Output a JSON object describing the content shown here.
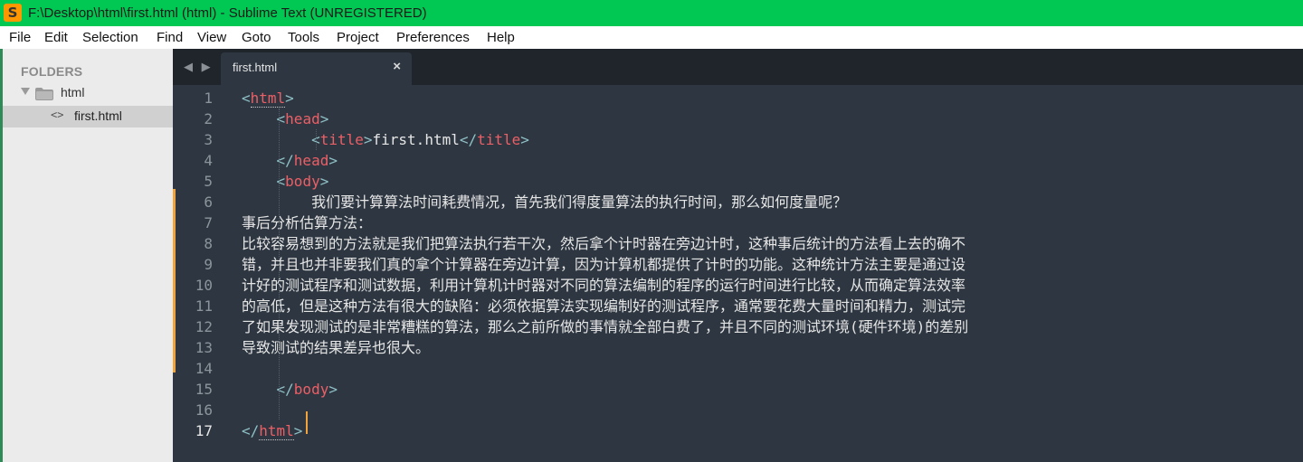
{
  "window": {
    "title": "F:\\Desktop\\html\\first.html (html) - Sublime Text (UNREGISTERED)",
    "app_icon": "S"
  },
  "menu": [
    "File",
    "Edit",
    "Selection",
    "Find",
    "View",
    "Goto",
    "Tools",
    "Project",
    "Preferences",
    "Help"
  ],
  "sidebar": {
    "heading": "FOLDERS",
    "folder": "html",
    "file": "first.html",
    "file_icon": "<>"
  },
  "tabbar": {
    "nav": "◀ ▶",
    "tab_label": "first.html",
    "close": "×"
  },
  "editor": {
    "active_line": 17,
    "line_numbers": [
      "1",
      "2",
      "3",
      "4",
      "5",
      "6",
      "7",
      "8",
      "9",
      "10",
      "11",
      "12",
      "13",
      "14",
      "15",
      "16",
      "17"
    ],
    "lines": [
      {
        "indent": "",
        "tag": "<html>",
        "type": "open",
        "name": "html"
      },
      {
        "indent": "    ",
        "type": "open",
        "name": "head"
      },
      {
        "indent": "        ",
        "type": "title",
        "name": "title",
        "content": "first.html"
      },
      {
        "indent": "    ",
        "type": "close",
        "name": "head"
      },
      {
        "indent": "    ",
        "type": "open",
        "name": "body"
      },
      {
        "indent": "        ",
        "type": "text",
        "content": "我们要计算算法时间耗费情况，首先我们得度量算法的执行时间，那么如何度量呢？"
      },
      {
        "indent": "",
        "type": "text",
        "content": "事后分析估算方法："
      },
      {
        "indent": "",
        "type": "text",
        "content": "比较容易想到的方法就是我们把算法执行若干次，然后拿个计时器在旁边计时，这种事后统计的方法看上去的确不"
      },
      {
        "indent": "",
        "type": "text",
        "content": "错，并且也并非要我们真的拿个计算器在旁边计算，因为计算机都提供了计时的功能。这种统计方法主要是通过设"
      },
      {
        "indent": "",
        "type": "text",
        "content": "计好的测试程序和测试数据，利用计算机计时器对不同的算法编制的程序的运行时间进行比较，从而确定算法效率"
      },
      {
        "indent": "",
        "type": "text",
        "content": "的高低，但是这种方法有很大的缺陷：必须依据算法实现编制好的测试程序，通常要花费大量时间和精力，测试完"
      },
      {
        "indent": "",
        "type": "text",
        "content": "了如果发现测试的是非常糟糕的算法，那么之前所做的事情就全部白费了，并且不同的测试环境(硬件环境)的差别"
      },
      {
        "indent": "",
        "type": "text",
        "content": "导致测试的结果差异也很大。"
      },
      {
        "indent": "",
        "type": "blank",
        "content": ""
      },
      {
        "indent": "    ",
        "type": "close",
        "name": "body"
      },
      {
        "indent": "",
        "type": "blank",
        "content": ""
      },
      {
        "indent": "",
        "type": "close",
        "name": "html"
      }
    ]
  },
  "colors": {
    "titlebar": "#00c853",
    "editor_bg": "#2e3741",
    "tag": "#ec5f66",
    "punct": "#8fc0c6",
    "text": "#e6e6e6",
    "caret": "#f2a43a"
  }
}
